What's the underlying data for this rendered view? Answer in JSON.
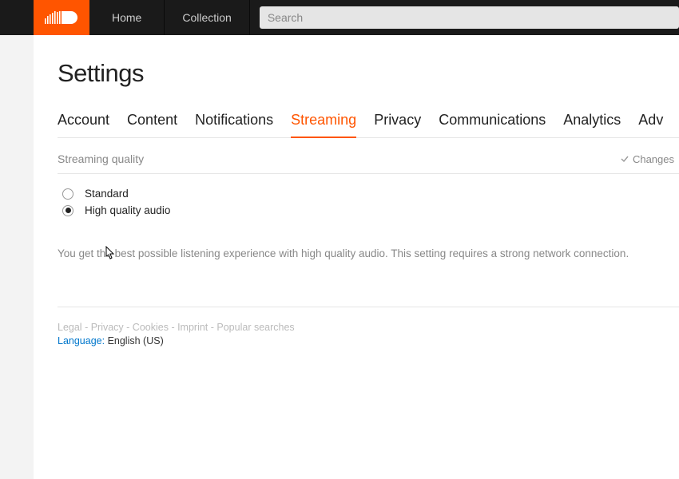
{
  "nav": {
    "home": "Home",
    "collection": "Collection"
  },
  "search": {
    "placeholder": "Search"
  },
  "page": {
    "title": "Settings"
  },
  "tabs": {
    "account": "Account",
    "content": "Content",
    "notifications": "Notifications",
    "streaming": "Streaming",
    "privacy": "Privacy",
    "communications": "Communications",
    "analytics": "Analytics",
    "advertising": "Adv"
  },
  "streaming": {
    "section_title": "Streaming quality",
    "saved_label": "Changes",
    "option_standard": "Standard",
    "option_hq": "High quality audio",
    "description": "You get the best possible listening experience with high quality audio. This setting requires a strong network connection."
  },
  "footer": {
    "legal": "Legal",
    "privacy": "Privacy",
    "cookies": "Cookies",
    "imprint": "Imprint",
    "popular": "Popular searches",
    "sep": " - ",
    "language_label": "Language:",
    "language_value": " English (US)"
  }
}
